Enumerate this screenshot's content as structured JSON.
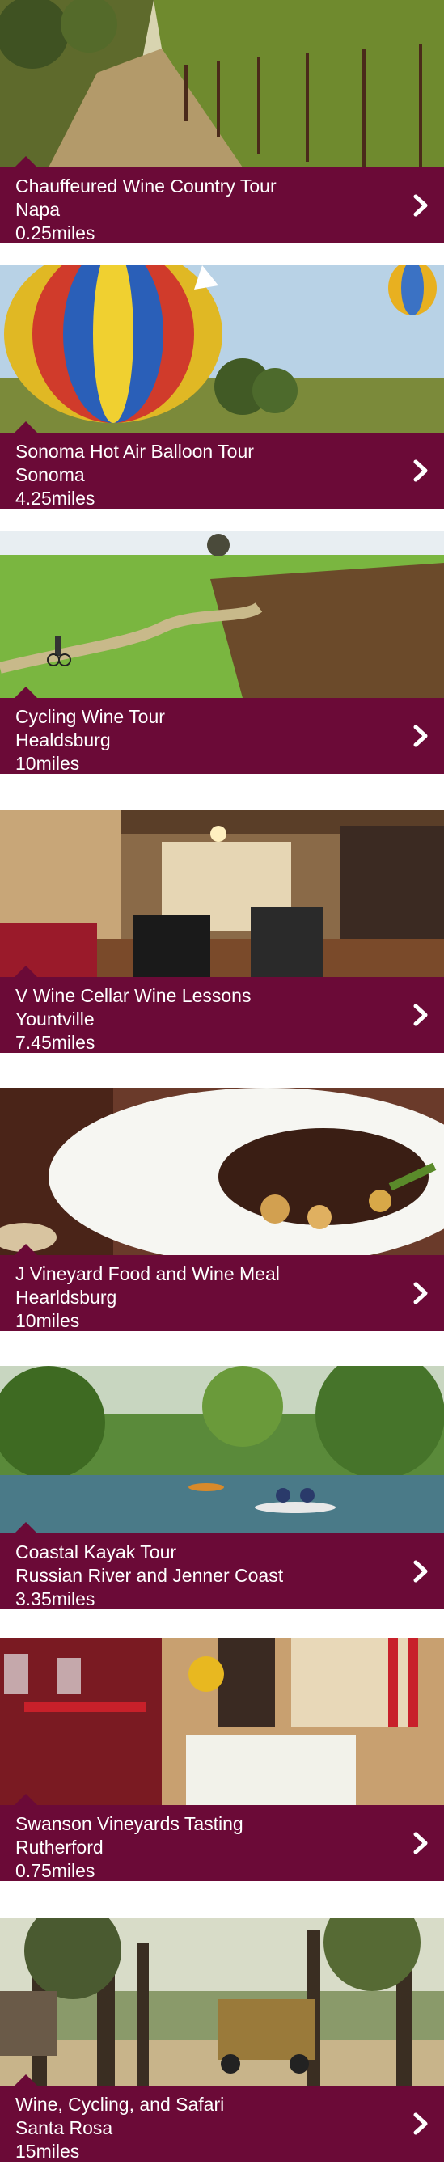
{
  "tours": [
    {
      "title": "Chauffeured Wine Country Tour",
      "location": "Napa",
      "distance": "0.25miles"
    },
    {
      "title": "Sonoma Hot Air Balloon Tour",
      "location": "Sonoma",
      "distance": "4.25miles"
    },
    {
      "title": "Cycling Wine Tour",
      "location": "Healdsburg",
      "distance": "10miles"
    },
    {
      "title": "V Wine Cellar Wine Lessons",
      "location": "Yountville",
      "distance": "7.45miles"
    },
    {
      "title": "J Vineyard Food and Wine Meal",
      "location": "Hearldsburg",
      "distance": "10miles"
    },
    {
      "title": "Coastal Kayak Tour",
      "location": "Russian River and Jenner Coast",
      "distance": "3.35miles"
    },
    {
      "title": "Swanson Vineyards Tasting",
      "location": "Rutherford",
      "distance": "0.75miles"
    },
    {
      "title": "Wine, Cycling, and Safari",
      "location": "Santa Rosa",
      "distance": "15miles"
    }
  ],
  "icons": {
    "detail": "chevron-right-icon"
  },
  "colors": {
    "caption_bg": "#6b0a37",
    "caption_text": "#ffffff"
  }
}
